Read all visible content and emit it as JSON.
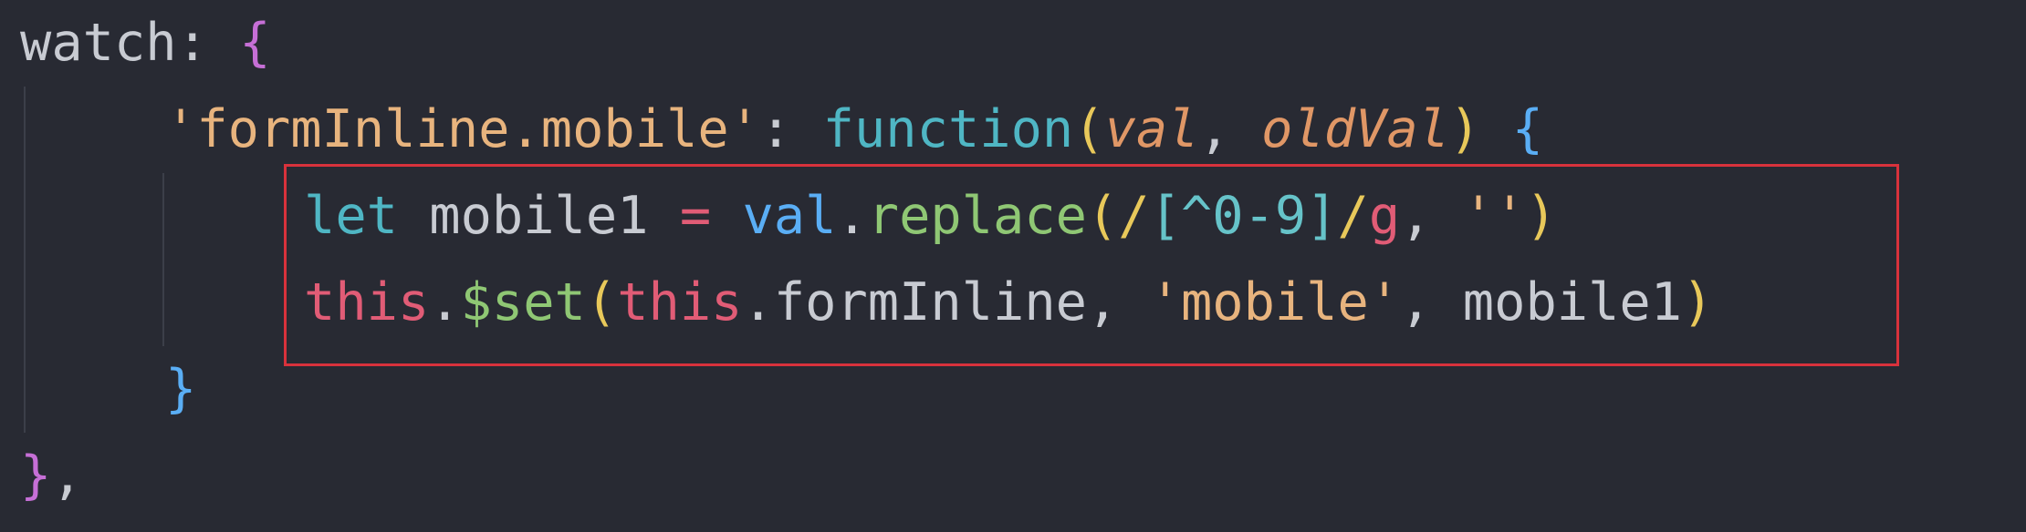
{
  "code": {
    "line1": {
      "key": "watch",
      "colon": ": ",
      "open_brace": "{"
    },
    "line2": {
      "key_string": "'formInline.mobile'",
      "colon": ": ",
      "function_kw": "function",
      "open_paren": "(",
      "param1": "val",
      "comma": ", ",
      "param2": "oldVal",
      "close_paren": ")",
      "space": " ",
      "open_brace": "{"
    },
    "line3": {
      "let_kw": "let",
      "var_name": " mobile1 ",
      "equals": "=",
      "space": " ",
      "val": "val",
      "dot": ".",
      "method": "replace",
      "open_paren": "(",
      "regex_slash1": "/",
      "regex_body": "[^0-9]",
      "regex_slash2": "/",
      "regex_flag": "g",
      "comma": ", ",
      "empty_string": "''",
      "close_paren": ")"
    },
    "line4": {
      "this1": "this",
      "dot1": ".",
      "method": "$set",
      "open_paren": "(",
      "this2": "this",
      "prop": ".formInline, ",
      "string": "'mobile'",
      "rest": ", mobile1",
      "close_paren": ")"
    },
    "line5": {
      "close_brace": "}"
    },
    "line6": {
      "close_brace": "}",
      "comma": ","
    }
  },
  "colors": {
    "background": "#282a33",
    "highlight_border": "#d8323c"
  }
}
